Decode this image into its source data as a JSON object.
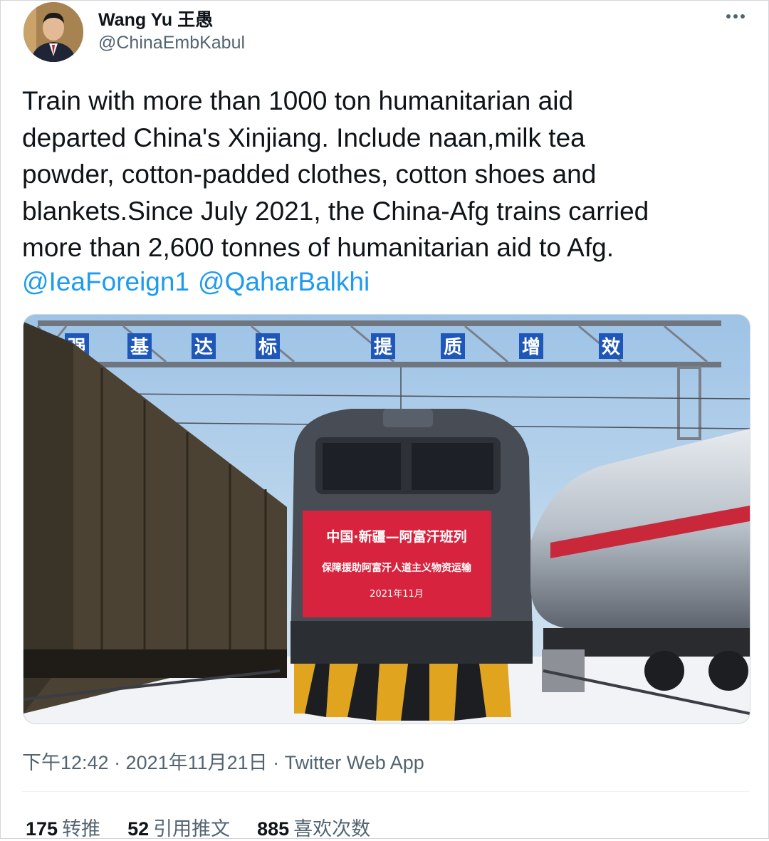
{
  "tweet": {
    "author": {
      "display_name": "Wang Yu 王愚",
      "handle": "@ChinaEmbKabul"
    },
    "more_icon": "more-horizontal-icon",
    "text": "Train with more than 1000 ton humanitarian aid\ndeparted China's Xinjiang. Include naan,milk tea\npowder, cotton-padded clothes, cotton shoes and\nblankets.Since July 2021, the China-Afg trains carried\nmore than 2,600 tonnes of humanitarian aid to Afg.",
    "mentions": [
      "@IeaForeign1",
      "@QaharBalkhi"
    ],
    "media": {
      "gantry_chars": [
        "强",
        "基",
        "达",
        "标",
        "提",
        "质",
        "增",
        "效"
      ],
      "banner_line1": "中国·新疆—阿富汗班列",
      "banner_line2": "保障援助阿富汗人道主义物资运输",
      "banner_line3": "2021年11月"
    },
    "meta": "下午12:42 · 2021年11月21日 · Twitter Web App",
    "stats": [
      {
        "count": "175",
        "label": "转推"
      },
      {
        "count": "52",
        "label": "引用推文"
      },
      {
        "count": "885",
        "label": "喜欢次数"
      }
    ]
  },
  "colors": {
    "link": "#1d9bf0",
    "text": "#0f1419",
    "secondary": "#536471",
    "banner_red": "#d8233e"
  }
}
